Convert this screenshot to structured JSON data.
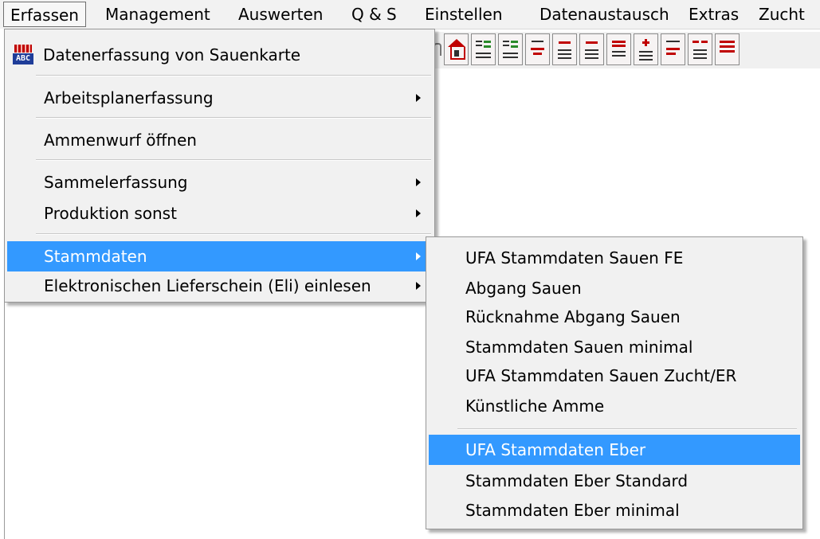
{
  "menubar": {
    "items": [
      "Erfassen",
      "Management",
      "Auswerten",
      "Q & S",
      "Einstellen",
      "Datenaustausch",
      "Extras",
      "Zucht"
    ]
  },
  "erfassen_menu": {
    "header_item": {
      "label": "Datenerfassung von Sauenkarte",
      "icon": "abc-sow-card-icon"
    },
    "item_arbeitsplan": "Arbeitsplanerfassung",
    "item_ammenwurf": "Ammenwurf öffnen",
    "item_sammel": "Sammelerfassung",
    "item_produktion": "Produktion sonst",
    "item_stammdaten": "Stammdaten",
    "item_eli": "Elektronischen Lieferschein (Eli) einlesen"
  },
  "stammdaten_submenu": {
    "items": [
      "UFA Stammdaten Sauen FE",
      "Abgang Sauen",
      "Rücknahme Abgang Sauen",
      "Stammdaten Sauen minimal",
      "UFA Stammdaten Sauen Zucht/ER",
      "Künstliche Amme",
      "UFA Stammdaten Eber",
      "Stammdaten Eber Standard",
      "Stammdaten Eber minimal"
    ],
    "highlighted": "UFA Stammdaten Eber"
  },
  "toolbar": {
    "icons": [
      "help-icon",
      "barn-icon",
      "sort-desc-icon",
      "sort-asc-icon",
      "count-132-icon",
      "pig-list-icon",
      "pig-list-2-icon",
      "pig-list-3-icon",
      "add-pig-icon",
      "pig-465-icon",
      "pig-group-icon",
      "pig-red-icon"
    ]
  },
  "colors": {
    "highlight": "#3399ff",
    "menu_bg": "#f1f1f1",
    "accent_red": "#c00000"
  }
}
